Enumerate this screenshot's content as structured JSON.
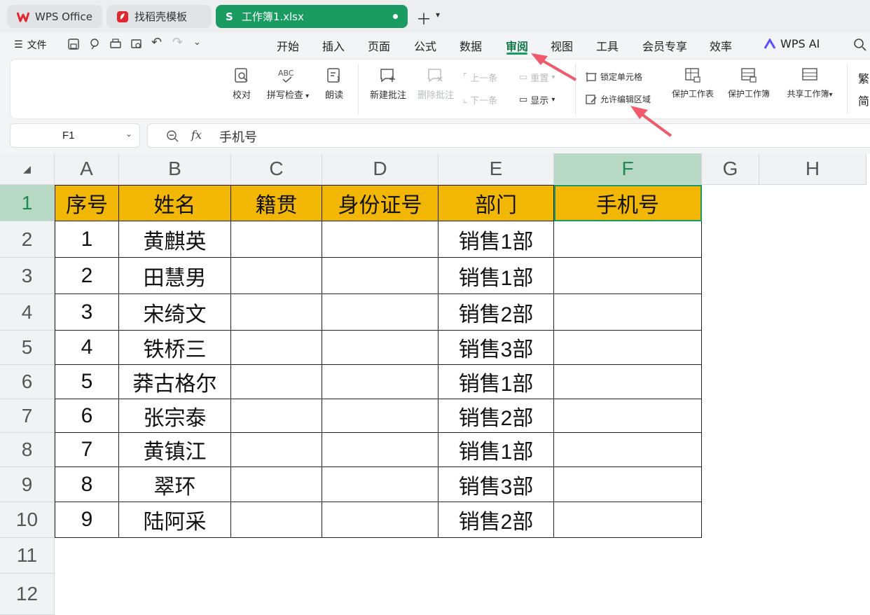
{
  "tabs": [
    {
      "label": "WPS Office",
      "icon": "wps-logo-icon"
    },
    {
      "label": "找稻壳模板",
      "icon": "docer-logo-icon"
    },
    {
      "label": "工作簿1.xlsx",
      "icon": "sheet-s-icon",
      "active": true
    }
  ],
  "menu": {
    "file_label": "文件",
    "items": [
      "开始",
      "插入",
      "页面",
      "公式",
      "数据",
      "审阅",
      "视图",
      "工具",
      "会员专享",
      "效率"
    ],
    "active": "审阅",
    "ai_label": "WPS AI"
  },
  "ribbon": {
    "proofread": "校对",
    "spellcheck": "拼写检查",
    "read_aloud": "朗读",
    "new_comment": "新建批注",
    "delete_comment": "删除批注",
    "prev": "上一条",
    "next": "下一条",
    "reset": "重置",
    "show": "显示",
    "lock_cell": "锁定单元格",
    "allow_edit": "允许编辑区域",
    "protect_sheet": "保护工作表",
    "protect_book": "保护工作簿",
    "share_book": "共享工作簿",
    "trad": "繁",
    "simp": "简"
  },
  "formula_bar": {
    "cell_ref": "F1",
    "fx": "fx",
    "content": "手机号"
  },
  "sheet": {
    "columns": [
      "A",
      "B",
      "C",
      "D",
      "E",
      "F",
      "G",
      "H"
    ],
    "rows": [
      "1",
      "2",
      "3",
      "4",
      "5",
      "6",
      "7",
      "8",
      "9",
      "10",
      "11",
      "12"
    ],
    "selected_cell": "F1",
    "headers": [
      "序号",
      "姓名",
      "籍贯",
      "身份证号",
      "部门",
      "手机号"
    ],
    "data": [
      [
        "1",
        "黄麒英",
        "",
        "",
        "销售1部",
        ""
      ],
      [
        "2",
        "田慧男",
        "",
        "",
        "销售1部",
        ""
      ],
      [
        "3",
        "宋绮文",
        "",
        "",
        "销售2部",
        ""
      ],
      [
        "4",
        "铁桥三",
        "",
        "",
        "销售3部",
        ""
      ],
      [
        "5",
        "莽古格尔",
        "",
        "",
        "销售1部",
        ""
      ],
      [
        "6",
        "张宗泰",
        "",
        "",
        "销售2部",
        ""
      ],
      [
        "7",
        "黄镇江",
        "",
        "",
        "销售1部",
        ""
      ],
      [
        "8",
        "翠环",
        "",
        "",
        "销售3部",
        ""
      ],
      [
        "9",
        "陆阿采",
        "",
        "",
        "销售2部",
        ""
      ]
    ],
    "header_fill": "#F2B705"
  },
  "colors": {
    "accent": "#1A9B62",
    "arrow": "#F05A6A"
  }
}
